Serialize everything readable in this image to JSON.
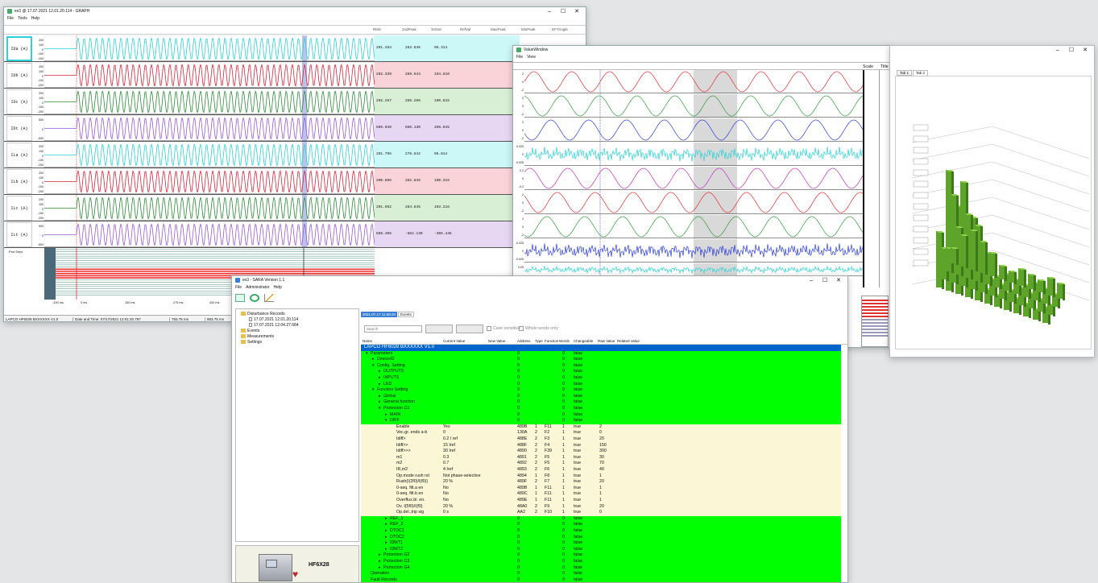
{
  "graph_window": {
    "title": "ex3 @ 17.07.2021 12.01.20.114 - GRAPH",
    "menu": [
      "File",
      "Tools",
      "Help"
    ],
    "columns": [
      "RMS",
      "2ndPeak",
      "3rdVal",
      "RefVal",
      "MaxPeak",
      "MinPeak",
      "DFTAngle"
    ],
    "channels": [
      {
        "name": "IDa (A)",
        "color": "#2bd1d6",
        "bg": "#ccf8f8",
        "ticks": [
          "200",
          "100",
          "0",
          "-100",
          "-200"
        ],
        "rms": "201.264",
        "v2": "283.845",
        "v3": "96.314",
        "max": "296.043"
      },
      {
        "name": "IDb (A)",
        "color": "#d9243a",
        "bg": "#f9d3d7",
        "ticks": [
          "200",
          "100",
          "0",
          "-100",
          "-200"
        ],
        "rms": "202.339",
        "v2": "289.644",
        "v3": "104.810",
        "max": "295.466"
      },
      {
        "name": "IDc (A)",
        "color": "#2e8b3a",
        "bg": "#d8efd6",
        "ticks": [
          "200",
          "100",
          "0",
          "-100",
          "-200"
        ],
        "rms": "202.267",
        "v2": "285.265",
        "v3": "100.815",
        "max": "296.043"
      },
      {
        "name": "IDt (A)",
        "color": "#9b59d6",
        "bg": "#e7d7f3",
        "ticks": [
          "500",
          "0",
          "-500"
        ],
        "rms": "605.040",
        "v2": "860.130",
        "v3": "298.045",
        "max": "861.730"
      },
      {
        "name": "ILa (A)",
        "color": "#2bd1d6",
        "bg": "#ccf8f8",
        "ticks": [
          "200",
          "100",
          "0",
          "-100",
          "-200"
        ],
        "rms": "201.795",
        "v2": "278.842",
        "v3": "96.814",
        "max": "279.262"
      },
      {
        "name": "ILb (A)",
        "color": "#d9243a",
        "bg": "#f9d3d7",
        "ticks": [
          "200",
          "100",
          "0",
          "-100",
          "-200"
        ],
        "rms": "200.885",
        "v2": "282.845",
        "v3": "100.315",
        "max": "282.845"
      },
      {
        "name": "ILc (A)",
        "color": "#2e8b3a",
        "bg": "#d8efd6",
        "ticks": [
          "200",
          "100",
          "0",
          "-100",
          "-200"
        ],
        "rms": "201.502",
        "v2": "284.845",
        "v3": "103.216",
        "max": "286.845"
      },
      {
        "name": "ILt (A)",
        "color": "#9b59d6",
        "bg": "#e7d7f3",
        "ticks": [
          "500",
          "0",
          "-500"
        ],
        "rms": "608.406",
        "v2": "-862.130",
        "v3": "-306.446",
        "max": "856.134"
      }
    ],
    "digital_label": "Prot Dept",
    "time_ticks": [
      "-100 ms",
      "0 ms",
      "150 ms",
      "275 ms",
      "400 ms"
    ],
    "status": [
      "LAPCO HF6028 BXXXXXX V1.0",
      "Date and Time: 07/17/2021 12:01:20.797",
      "783.75 ms",
      "883.75 ms",
      "1254"
    ]
  },
  "waves_window": {
    "title": "ValueWindow",
    "menu": [
      "File",
      "View"
    ],
    "col_headers": [
      "Scale",
      "Title"
    ],
    "rows": [
      {
        "color": "#e03030",
        "ticks": [
          "2",
          "0",
          "-2"
        ]
      },
      {
        "color": "#2e9b3a",
        "ticks": [
          "2",
          "0",
          "-2"
        ]
      },
      {
        "color": "#2c3fd6",
        "ticks": [
          "2",
          "0",
          "-2"
        ]
      },
      {
        "color": "#2bd1d6",
        "ticks": [
          "0.025",
          "0",
          "-0.025"
        ]
      },
      {
        "color": "#c030c0",
        "ticks": [
          "0.2",
          "0",
          "-0.2"
        ]
      },
      {
        "color": "#e03030",
        "ticks": [
          "2",
          "0",
          "-2"
        ]
      },
      {
        "color": "#2e9b3a",
        "ticks": [
          "2",
          "0",
          "-2"
        ]
      },
      {
        "color": "#2c3fd6",
        "ticks": [
          "0.025",
          "0",
          "-0.025"
        ]
      },
      {
        "color": "#2bd1d6",
        "ticks": [
          "0.05"
        ]
      }
    ]
  },
  "bar3d_window": {
    "tabs": [
      "Tab 1",
      "Tab 2"
    ]
  },
  "sara_window": {
    "title": "ex3 - SARA Version 1.1",
    "menu": [
      "File",
      "Administrator",
      "Help"
    ],
    "left_tree": [
      {
        "label": "Disturbance Records",
        "level": 0
      },
      {
        "label": "17.07.2021 12.01.20.114",
        "level": 1
      },
      {
        "label": "17.07.2021 12.04.27.684",
        "level": 1
      },
      {
        "label": "Events",
        "level": 0
      },
      {
        "label": "Measurements",
        "level": 0
      },
      {
        "label": "Settings",
        "level": 0
      }
    ],
    "tabs": [
      "2021.07.17 11.58.04",
      "Events"
    ],
    "search_placeholder": "Search",
    "case_sensitive": "Case sensitive",
    "whole_words": "Whole words only",
    "headers": [
      "Name",
      "Current Value",
      "New Value",
      "Address",
      "Type",
      "Function",
      "Words",
      "Changeable",
      "Raw Value",
      "Related Value"
    ],
    "device_name": "HF6X28",
    "rows": [
      {
        "name": "LAPCO HF6028 BXXXXXX V1.0",
        "ind": 0,
        "style": "sel",
        "cur": "",
        "addr": "",
        "type": "",
        "fn": "",
        "words": "",
        "chg": "",
        "raw": ""
      },
      {
        "name": "Parameters",
        "ind": 1,
        "style": "grn",
        "arrow": "▾",
        "cur": "",
        "addr": "0",
        "type": "",
        "fn": "",
        "words": "0",
        "chg": "false",
        "raw": ""
      },
      {
        "name": "DeviceID",
        "ind": 2,
        "style": "grn",
        "arrow": "▸",
        "cur": "",
        "addr": "0",
        "type": "",
        "fn": "",
        "words": "0",
        "chg": "false",
        "raw": ""
      },
      {
        "name": "Config. Setting",
        "ind": 2,
        "style": "grn",
        "arrow": "▾",
        "cur": "",
        "addr": "0",
        "type": "",
        "fn": "",
        "words": "0",
        "chg": "false",
        "raw": ""
      },
      {
        "name": "OUTPUTS",
        "ind": 3,
        "style": "grn",
        "arrow": "▸",
        "cur": "",
        "addr": "0",
        "type": "",
        "fn": "",
        "words": "0",
        "chg": "false",
        "raw": ""
      },
      {
        "name": "INPUTS",
        "ind": 3,
        "style": "grn",
        "arrow": "▸",
        "cur": "",
        "addr": "0",
        "type": "",
        "fn": "",
        "words": "0",
        "chg": "false",
        "raw": ""
      },
      {
        "name": "LED",
        "ind": 3,
        "style": "grn",
        "arrow": "▸",
        "cur": "",
        "addr": "0",
        "type": "",
        "fn": "",
        "words": "0",
        "chg": "false",
        "raw": ""
      },
      {
        "name": "Function Setting",
        "ind": 2,
        "style": "grn",
        "arrow": "▾",
        "cur": "",
        "addr": "0",
        "type": "",
        "fn": "",
        "words": "0",
        "chg": "false",
        "raw": ""
      },
      {
        "name": "Global",
        "ind": 3,
        "style": "grn",
        "arrow": "▸",
        "cur": "",
        "addr": "0",
        "type": "",
        "fn": "",
        "words": "0",
        "chg": "false",
        "raw": ""
      },
      {
        "name": "General function",
        "ind": 3,
        "style": "grn",
        "arrow": "▸",
        "cur": "",
        "addr": "0",
        "type": "",
        "fn": "",
        "words": "0",
        "chg": "false",
        "raw": ""
      },
      {
        "name": "Protection G1",
        "ind": 3,
        "style": "grn",
        "arrow": "▾",
        "cur": "",
        "addr": "0",
        "type": "",
        "fn": "",
        "words": "0",
        "chg": "false",
        "raw": ""
      },
      {
        "name": "MAIN",
        "ind": 4,
        "style": "grn",
        "arrow": "▸",
        "cur": "",
        "addr": "0",
        "type": "",
        "fn": "",
        "words": "0",
        "chg": "false",
        "raw": ""
      },
      {
        "name": "DIFF",
        "ind": 4,
        "style": "grn",
        "arrow": "▾",
        "cur": "",
        "addr": "0",
        "type": "",
        "fn": "",
        "words": "0",
        "chg": "false",
        "raw": ""
      },
      {
        "name": "Enable",
        "ind": 5,
        "style": "cream",
        "cur": "Yes",
        "addr": "489B",
        "type": "1",
        "fn": "F11",
        "words": "1",
        "chg": "true",
        "raw": "2"
      },
      {
        "name": "Vec.gr. ends a-b",
        "ind": 5,
        "style": "cream",
        "cur": "0",
        "addr": "130A",
        "type": "2",
        "fn": "F2",
        "words": "1",
        "chg": "true",
        "raw": "0"
      },
      {
        "name": "Idiff>",
        "ind": 5,
        "style": "cream",
        "cur": "0.2 I ref",
        "addr": "488E",
        "type": "2",
        "fn": "F3",
        "words": "1",
        "chg": "true",
        "raw": "20"
      },
      {
        "name": "Idiff>>",
        "ind": 5,
        "style": "cream",
        "cur": "15 Iref",
        "addr": "488F",
        "type": "2",
        "fn": "F4",
        "words": "1",
        "chg": "true",
        "raw": "150"
      },
      {
        "name": "Idiff>>>",
        "ind": 5,
        "style": "cream",
        "cur": "30 Iref",
        "addr": "4890",
        "type": "2",
        "fn": "F39",
        "words": "1",
        "chg": "true",
        "raw": "300"
      },
      {
        "name": "m1",
        "ind": 5,
        "style": "cream",
        "cur": "0.3",
        "addr": "4891",
        "type": "2",
        "fn": "F5",
        "words": "1",
        "chg": "true",
        "raw": "30"
      },
      {
        "name": "m2",
        "ind": 5,
        "style": "cream",
        "cur": "0.7",
        "addr": "4892",
        "type": "2",
        "fn": "F5",
        "words": "1",
        "chg": "true",
        "raw": "70"
      },
      {
        "name": "IR,m2",
        "ind": 5,
        "style": "cream",
        "cur": "4 Iref",
        "addr": "4893",
        "type": "2",
        "fn": "F6",
        "words": "1",
        "chg": "true",
        "raw": "40"
      },
      {
        "name": "Op.mode rush rst",
        "ind": 5,
        "style": "cream",
        "cur": "Not phase-selective",
        "addr": "4894",
        "type": "1",
        "fn": "F8",
        "words": "1",
        "chg": "true",
        "raw": "1"
      },
      {
        "name": "Rush(I(2f0)/I(f0))",
        "ind": 5,
        "style": "cream",
        "cur": "20 %",
        "addr": "489F",
        "type": "2",
        "fn": "F7",
        "words": "1",
        "chg": "true",
        "raw": "20"
      },
      {
        "name": "0-seq. filt.a en",
        "ind": 5,
        "style": "cream",
        "cur": "No",
        "addr": "489B",
        "type": "1",
        "fn": "F11",
        "words": "1",
        "chg": "true",
        "raw": "1"
      },
      {
        "name": "0-seq. filt.b en",
        "ind": 5,
        "style": "cream",
        "cur": "No",
        "addr": "489C",
        "type": "1",
        "fn": "F11",
        "words": "1",
        "chg": "true",
        "raw": "1"
      },
      {
        "name": "Overflux.bl. en.",
        "ind": 5,
        "style": "cream",
        "cur": "No",
        "addr": "489E",
        "type": "1",
        "fn": "F11",
        "words": "1",
        "chg": "true",
        "raw": "1"
      },
      {
        "name": "Ov. I(5f0)/I(f0)",
        "ind": 5,
        "style": "cream",
        "cur": "20 %",
        "addr": "48A0",
        "type": "2",
        "fn": "F9",
        "words": "1",
        "chg": "true",
        "raw": "20"
      },
      {
        "name": "Op.del.,trip sig",
        "ind": 5,
        "style": "cream",
        "cur": "0 s",
        "addr": "AA2",
        "type": "2",
        "fn": "F10",
        "words": "1",
        "chg": "true",
        "raw": "0"
      },
      {
        "name": "REF_1",
        "ind": 4,
        "style": "grn",
        "arrow": "▸",
        "cur": "",
        "addr": "0",
        "type": "",
        "fn": "",
        "words": "0",
        "chg": "false",
        "raw": ""
      },
      {
        "name": "REF_2",
        "ind": 4,
        "style": "grn",
        "arrow": "▸",
        "cur": "",
        "addr": "0",
        "type": "",
        "fn": "",
        "words": "0",
        "chg": "false",
        "raw": ""
      },
      {
        "name": "DTOC1",
        "ind": 4,
        "style": "grn",
        "arrow": "▸",
        "cur": "",
        "addr": "0",
        "type": "",
        "fn": "",
        "words": "0",
        "chg": "false",
        "raw": ""
      },
      {
        "name": "DTOC2",
        "ind": 4,
        "style": "grn",
        "arrow": "▸",
        "cur": "",
        "addr": "0",
        "type": "",
        "fn": "",
        "words": "0",
        "chg": "false",
        "raw": ""
      },
      {
        "name": "IDMT1",
        "ind": 4,
        "style": "grn",
        "arrow": "▸",
        "cur": "",
        "addr": "0",
        "type": "",
        "fn": "",
        "words": "0",
        "chg": "false",
        "raw": ""
      },
      {
        "name": "IDMT2",
        "ind": 4,
        "style": "grn",
        "arrow": "▸",
        "cur": "",
        "addr": "0",
        "type": "",
        "fn": "",
        "words": "0",
        "chg": "false",
        "raw": ""
      },
      {
        "name": "Protection G2",
        "ind": 3,
        "style": "grn",
        "arrow": "▸",
        "cur": "",
        "addr": "0",
        "type": "",
        "fn": "",
        "words": "0",
        "chg": "false",
        "raw": ""
      },
      {
        "name": "Protection G3",
        "ind": 3,
        "style": "grn",
        "arrow": "▸",
        "cur": "",
        "addr": "0",
        "type": "",
        "fn": "",
        "words": "0",
        "chg": "false",
        "raw": ""
      },
      {
        "name": "Protection G4",
        "ind": 3,
        "style": "grn",
        "arrow": "▸",
        "cur": "",
        "addr": "0",
        "type": "",
        "fn": "",
        "words": "0",
        "chg": "false",
        "raw": ""
      },
      {
        "name": "Operation",
        "ind": 1,
        "style": "grn",
        "cur": "",
        "addr": "0",
        "type": "",
        "fn": "",
        "words": "0",
        "chg": "false",
        "raw": ""
      },
      {
        "name": "Fault Records",
        "ind": 1,
        "style": "grn",
        "cur": "",
        "addr": "0",
        "type": "",
        "fn": "",
        "words": "0",
        "chg": "false",
        "raw": ""
      }
    ]
  }
}
